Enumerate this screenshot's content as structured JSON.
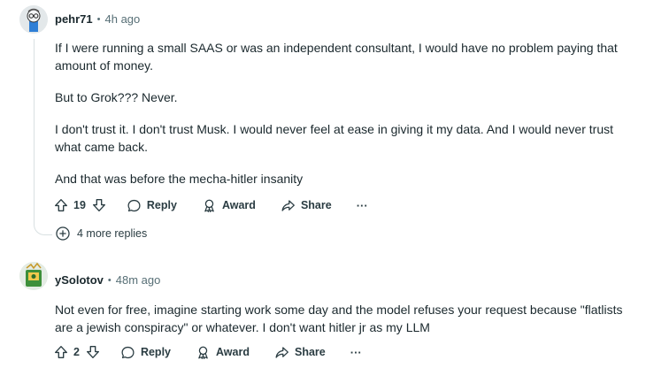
{
  "comments": [
    {
      "username": "pehr71",
      "separator": "•",
      "time": "4h ago",
      "paragraphs": [
        "If I were running a small SAAS or was an independent consultant, I would have no problem paying that amount of money.",
        "But to Grok??? Never.",
        "I don't trust it. I don't trust Musk. I would never feel at ease in giving it my data. And I would never trust what came back.",
        "And that was before the mecha-hitler insanity"
      ],
      "votes": "19",
      "reply_label": "Reply",
      "award_label": "Award",
      "share_label": "Share",
      "more_label": "···",
      "more_replies_label": "4 more replies"
    },
    {
      "username": "ySolotov",
      "separator": "•",
      "time": "48m ago",
      "paragraphs": [
        "Not even for free, imagine starting work some day and the model refuses your request because \"flatlists are a jewish conspiracy\" or whatever. I don't want hitler jr as my LLM"
      ],
      "votes": "2",
      "reply_label": "Reply",
      "award_label": "Award",
      "share_label": "Share",
      "more_label": "···"
    }
  ]
}
